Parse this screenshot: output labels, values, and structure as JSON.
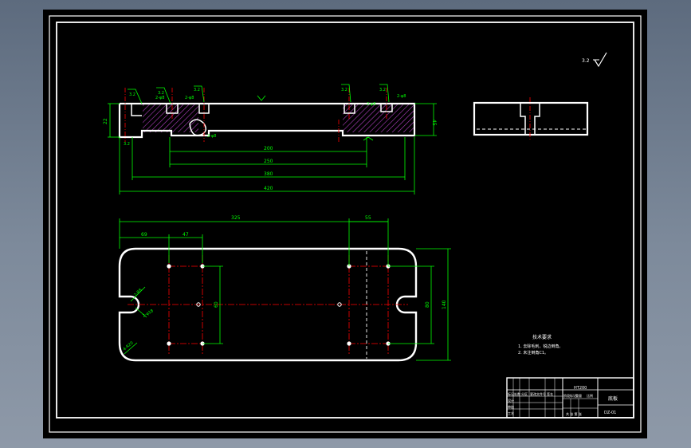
{
  "colors": {
    "background": "#000000",
    "outline": "#ffffff",
    "dimension": "#00ff00",
    "centerline": "#ff0000",
    "hatch": "#b040c0",
    "frame": "#ffffff",
    "desktop": "#7d8a9b"
  },
  "roughness_symbol": {
    "label": "3.2"
  },
  "section_view": {
    "roughness_labels": [
      "3.2",
      "3.2",
      "3.2",
      "3.2",
      "3.2",
      "3.2"
    ],
    "hole_callouts": [
      "2-φ8",
      "2-φ8",
      "2-φ8",
      "2-φ8",
      "2-φ8"
    ],
    "left_height": "22",
    "right_height": "45",
    "dimensions": [
      "200",
      "250",
      "380",
      "420"
    ]
  },
  "plan_view": {
    "top_dimensions": [
      "325",
      "55"
    ],
    "sub_dimensions": [
      "69",
      "47"
    ],
    "right_dimensions": [
      "60",
      "80",
      "140"
    ],
    "callouts": [
      "2-R8",
      "2-φ18",
      "4-R20"
    ]
  },
  "notes": {
    "title": "技术要求",
    "items": [
      "1. 去除毛刺，锐边倒角。",
      "2. 未注倒角C1。"
    ]
  },
  "title_block": {
    "drawing_name": "底板",
    "material": "HT200",
    "drawing_no": "DZ-01",
    "column_labels": [
      "标记",
      "处数",
      "分区",
      "更改文件号",
      "签名"
    ],
    "role_labels": [
      "设计",
      "审核",
      "工艺"
    ],
    "scale_labels": [
      "阶段标记",
      "重量",
      "比例"
    ],
    "sheet_label": "共 张 第 张"
  }
}
